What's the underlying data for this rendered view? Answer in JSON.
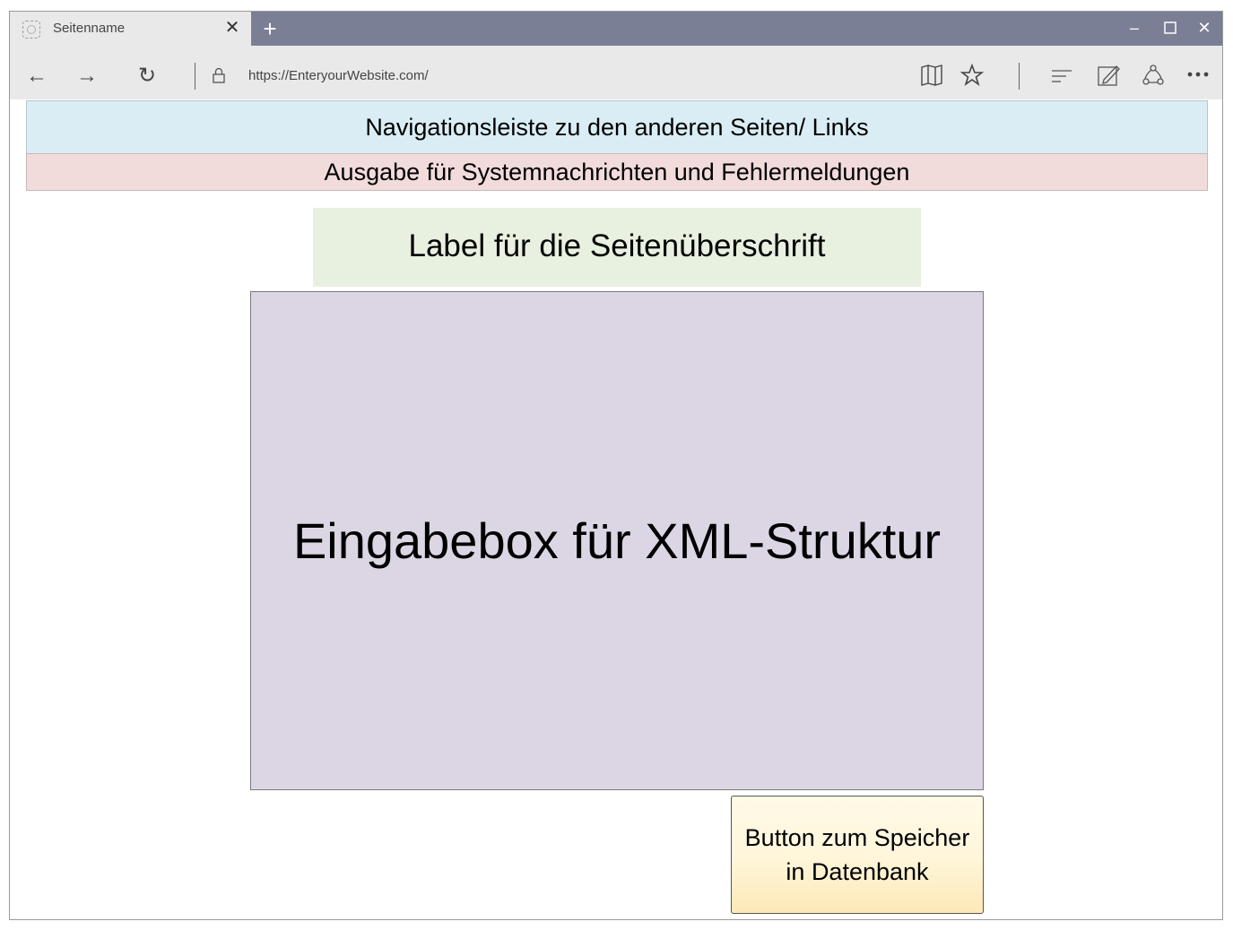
{
  "browser": {
    "tab_title": "Seitenname",
    "tab_close": "✕",
    "new_tab": "+",
    "window_controls": {
      "minimize": "–",
      "maximize": "☐",
      "close": "✕"
    },
    "nav": {
      "back": "←",
      "forward": "→",
      "refresh": "↻"
    },
    "url": "https://EnteryourWebsite.com/",
    "toolbar_icons": [
      "reading-view-icon",
      "favorite-star-icon",
      "hub-icon",
      "web-note-icon",
      "share-icon",
      "more-icon"
    ]
  },
  "page": {
    "navigation_bar": "Navigationsleiste zu den anderen Seiten/ Links",
    "system_messages": "Ausgabe für Systemnachrichten und Fehlermeldungen",
    "page_heading_label": "Label für die Seitenüberschrift",
    "xml_input_box": "Eingabebox für XML-Struktur",
    "save_button": "Button zum Speicher\nin Datenbank"
  },
  "colors": {
    "titlebar": "#7a7f96",
    "navigation_bar": "#daedf4",
    "system_messages": "#f1dbdb",
    "page_heading": "#e8f0e0",
    "xml_box": "#dcd6e4",
    "save_button": "#fff6dc"
  }
}
